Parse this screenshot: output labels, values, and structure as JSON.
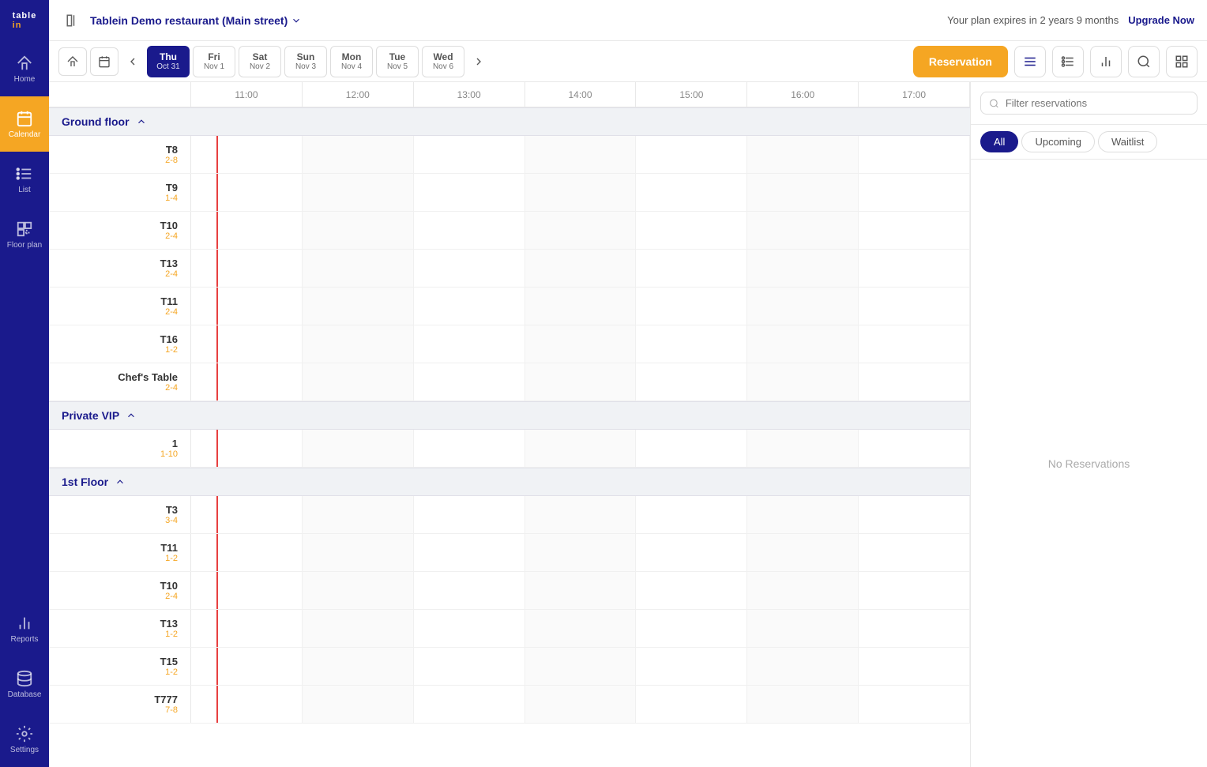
{
  "app": {
    "logo": "tablein"
  },
  "topbar": {
    "restaurant_name": "Tablein Demo restaurant (Main street)",
    "plan_notice": "Your plan expires in 2 years 9 months",
    "upgrade_label": "Upgrade Now"
  },
  "navbar": {
    "days": [
      {
        "id": "thu",
        "name": "Thu",
        "date": "Oct 31",
        "active": true
      },
      {
        "id": "fri",
        "name": "Fri",
        "date": "Nov 1",
        "active": false
      },
      {
        "id": "sat",
        "name": "Sat",
        "date": "Nov 2",
        "active": false
      },
      {
        "id": "sun",
        "name": "Sun",
        "date": "Nov 3",
        "active": false
      },
      {
        "id": "mon",
        "name": "Mon",
        "date": "Nov 4",
        "active": false
      },
      {
        "id": "tue",
        "name": "Tue",
        "date": "Nov 5",
        "active": false
      },
      {
        "id": "wed",
        "name": "Wed",
        "date": "Nov 6",
        "active": false
      }
    ],
    "reservation_btn": "Reservation"
  },
  "time_slots": [
    "11:00",
    "12:00",
    "13:00",
    "14:00",
    "15:00",
    "16:00",
    "17:00"
  ],
  "sections": [
    {
      "id": "ground-floor",
      "name": "Ground floor",
      "tables": [
        {
          "name": "T8",
          "capacity": "2-8"
        },
        {
          "name": "T9",
          "capacity": "1-4"
        },
        {
          "name": "T10",
          "capacity": "2-4"
        },
        {
          "name": "T13",
          "capacity": "2-4"
        },
        {
          "name": "T11",
          "capacity": "2-4"
        },
        {
          "name": "T16",
          "capacity": "1-2"
        },
        {
          "name": "Chef's Table",
          "capacity": "2-4"
        }
      ]
    },
    {
      "id": "private-vip",
      "name": "Private VIP",
      "tables": [
        {
          "name": "1",
          "capacity": "1-10"
        }
      ]
    },
    {
      "id": "1st-floor",
      "name": "1st Floor",
      "tables": [
        {
          "name": "T3",
          "capacity": "3-4"
        },
        {
          "name": "T11",
          "capacity": "1-2"
        },
        {
          "name": "T10",
          "capacity": "2-4"
        },
        {
          "name": "T13",
          "capacity": "1-2"
        },
        {
          "name": "T15",
          "capacity": "1-2"
        },
        {
          "name": "T777",
          "capacity": "7-8"
        }
      ]
    }
  ],
  "right_panel": {
    "search_placeholder": "Filter reservations",
    "tabs": [
      {
        "id": "all",
        "label": "All",
        "active": true
      },
      {
        "id": "upcoming",
        "label": "Upcoming",
        "active": false
      },
      {
        "id": "waitlist",
        "label": "Waitlist",
        "active": false
      }
    ],
    "no_reservations": "No Reservations"
  },
  "sidebar": {
    "items": [
      {
        "id": "home",
        "label": "Home",
        "active": false
      },
      {
        "id": "calendar",
        "label": "Calendar",
        "active": true
      },
      {
        "id": "list",
        "label": "List",
        "active": false
      },
      {
        "id": "floor-plan",
        "label": "Floor plan",
        "active": false
      },
      {
        "id": "reports",
        "label": "Reports",
        "active": false
      },
      {
        "id": "database",
        "label": "Database",
        "active": false
      },
      {
        "id": "settings",
        "label": "Settings",
        "active": false
      }
    ]
  }
}
